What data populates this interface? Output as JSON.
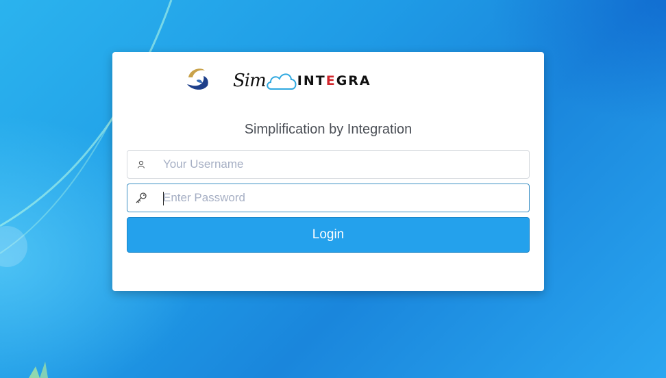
{
  "login": {
    "tagline": "Simplification by Integration",
    "username": {
      "placeholder": "Your Username",
      "value": "",
      "icon": "user-icon"
    },
    "password": {
      "placeholder": "Enter Password",
      "value": "",
      "icon": "key-icon"
    },
    "submit_label": "Login"
  },
  "brand": {
    "logo_text": "SimINTEGRA",
    "colors": {
      "cloud": "#2ea8e0",
      "accent_red": "#d1262c",
      "mark_gold": "#c9a24a",
      "mark_navy": "#1e3f8a"
    }
  },
  "theme": {
    "accent": "#24a1ec",
    "focus_border": "#3b8fc4"
  }
}
